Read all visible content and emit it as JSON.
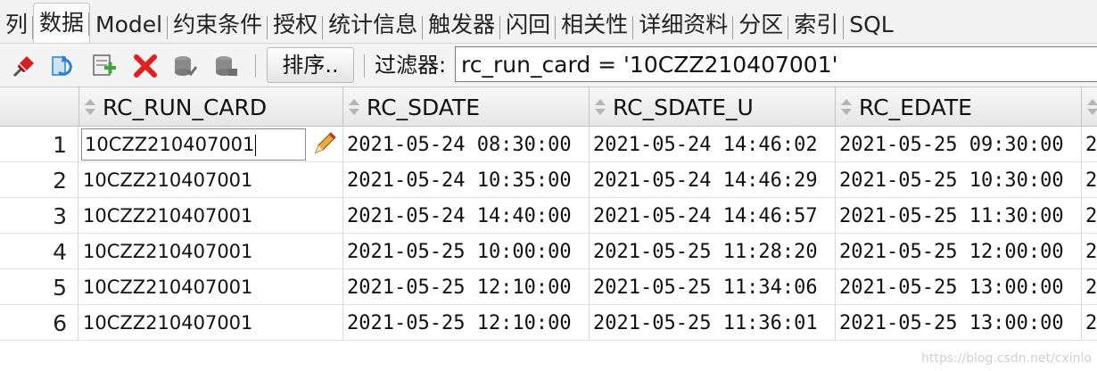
{
  "tabs": [
    "列",
    "数据",
    "Model",
    "约束条件",
    "授权",
    "统计信息",
    "触发器",
    "闪回",
    "相关性",
    "详细资料",
    "分区",
    "索引",
    "SQL"
  ],
  "active_tab": "数据",
  "toolbar": {
    "icons": [
      "pin-icon",
      "refresh-icon",
      "insert-row-icon",
      "delete-row-icon",
      "commit-icon",
      "rollback-icon"
    ],
    "sort_label": "排序..",
    "filter_label": "过滤器:",
    "filter_value": "rc_run_card = '10CZZ210407001'"
  },
  "grid": {
    "columns": [
      "RC_RUN_CARD",
      "RC_SDATE",
      "RC_SDATE_U",
      "RC_EDATE"
    ],
    "rows": [
      {
        "num": "1",
        "rc_run_card": "10CZZ210407001",
        "rc_sdate": "2021-05-24 08:30:00",
        "rc_sdate_u": "2021-05-24 14:46:02",
        "rc_edate": "2021-05-25 09:30:00",
        "more": "2"
      },
      {
        "num": "2",
        "rc_run_card": "10CZZ210407001",
        "rc_sdate": "2021-05-24 10:35:00",
        "rc_sdate_u": "2021-05-24 14:46:29",
        "rc_edate": "2021-05-25 10:30:00",
        "more": "2"
      },
      {
        "num": "3",
        "rc_run_card": "10CZZ210407001",
        "rc_sdate": "2021-05-24 14:40:00",
        "rc_sdate_u": "2021-05-24 14:46:57",
        "rc_edate": "2021-05-25 11:30:00",
        "more": "2"
      },
      {
        "num": "4",
        "rc_run_card": "10CZZ210407001",
        "rc_sdate": "2021-05-25 10:00:00",
        "rc_sdate_u": "2021-05-25 11:28:20",
        "rc_edate": "2021-05-25 12:00:00",
        "more": "2"
      },
      {
        "num": "5",
        "rc_run_card": "10CZZ210407001",
        "rc_sdate": "2021-05-25 12:10:00",
        "rc_sdate_u": "2021-05-25 11:34:06",
        "rc_edate": "2021-05-25 13:00:00",
        "more": "2"
      },
      {
        "num": "6",
        "rc_run_card": "10CZZ210407001",
        "rc_sdate": "2021-05-25 12:10:00",
        "rc_sdate_u": "2021-05-25 11:36:01",
        "rc_edate": "2021-05-25 13:00:00",
        "more": "2"
      }
    ],
    "selected_row": "1"
  },
  "watermark": "https://blog.csdn.net/cxinlo",
  "colors": {
    "accent": "#ff8c00",
    "delete": "#e02020",
    "refresh": "#2a7fd4",
    "add": "#3aa53a"
  }
}
